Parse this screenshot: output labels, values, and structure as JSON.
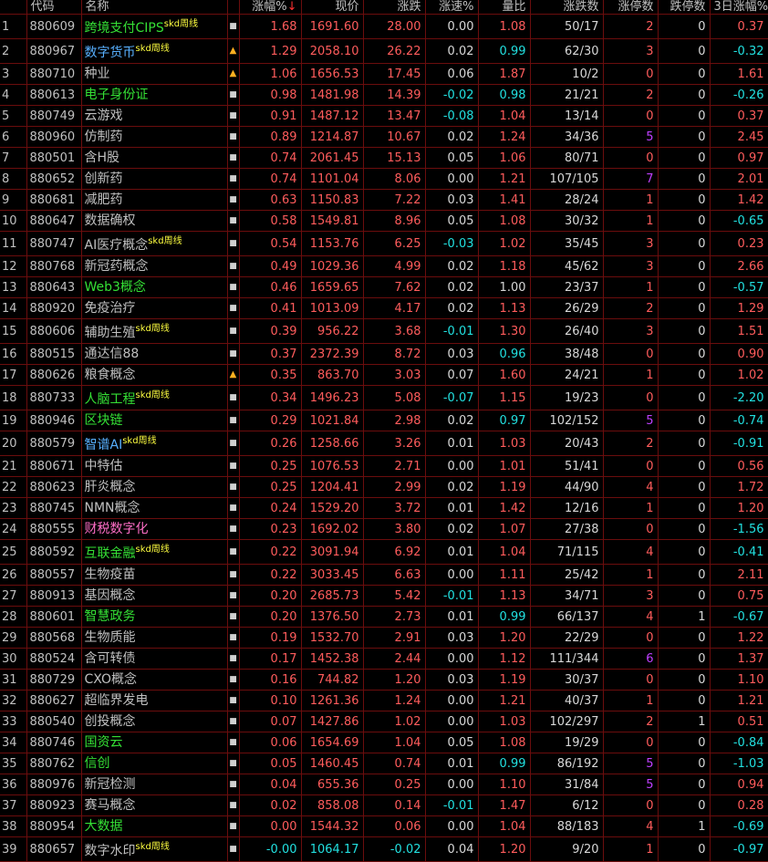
{
  "columns": [
    "代码",
    "名称",
    "",
    "涨幅%",
    "现价",
    "涨跌",
    "涨速%",
    "量比",
    "涨跌数",
    "涨停数",
    "跌停数",
    "3日涨幅%"
  ],
  "rows": [
    {
      "i": "1",
      "code": "880609",
      "name": "跨境支付CIPS",
      "nc": "n-green",
      "skd": "skd周线",
      "bell": "",
      "pct": "1.68",
      "price": "1691.60",
      "chg": "28.00",
      "spd": "0.00",
      "vol": "1.08",
      "vc": "red",
      "ud": "50/17",
      "up": "2",
      "upc": "red",
      "dn": "0",
      "d3": "0.37",
      "d3c": "red"
    },
    {
      "i": "2",
      "code": "880967",
      "name": "数字货币",
      "nc": "n-blue",
      "skd": "skd周线",
      "bell": "bell",
      "pct": "1.29",
      "price": "2058.10",
      "chg": "26.22",
      "spd": "0.02",
      "vol": "0.99",
      "vc": "cyan",
      "ud": "62/30",
      "up": "3",
      "upc": "red",
      "dn": "0",
      "d3": "-0.32",
      "d3c": "cyan"
    },
    {
      "i": "3",
      "code": "880710",
      "name": "种业",
      "nc": "n-default",
      "skd": "",
      "bell": "bell",
      "pct": "1.06",
      "price": "1656.53",
      "chg": "17.45",
      "spd": "0.06",
      "vol": "1.87",
      "vc": "red",
      "ud": "10/2",
      "up": "0",
      "upc": "red",
      "dn": "0",
      "d3": "1.61",
      "d3c": "red"
    },
    {
      "i": "4",
      "code": "880613",
      "name": "电子身份证",
      "nc": "n-green",
      "skd": "",
      "bell": "",
      "pct": "0.98",
      "price": "1481.98",
      "chg": "14.39",
      "spd": "-0.02",
      "vol": "0.98",
      "vc": "cyan",
      "ud": "21/21",
      "up": "2",
      "upc": "red",
      "dn": "0",
      "d3": "-0.26",
      "d3c": "cyan"
    },
    {
      "i": "5",
      "code": "880749",
      "name": "云游戏",
      "nc": "n-default",
      "skd": "",
      "bell": "",
      "pct": "0.91",
      "price": "1487.12",
      "chg": "13.47",
      "spd": "-0.08",
      "vol": "1.04",
      "vc": "red",
      "ud": "13/14",
      "up": "0",
      "upc": "red",
      "dn": "0",
      "d3": "0.37",
      "d3c": "red"
    },
    {
      "i": "6",
      "code": "880960",
      "name": "仿制药",
      "nc": "n-default",
      "skd": "",
      "bell": "",
      "pct": "0.89",
      "price": "1214.87",
      "chg": "10.67",
      "spd": "0.02",
      "vol": "1.24",
      "vc": "red",
      "ud": "34/36",
      "up": "5",
      "upc": "mag",
      "dn": "0",
      "d3": "2.45",
      "d3c": "red"
    },
    {
      "i": "7",
      "code": "880501",
      "name": "含H股",
      "nc": "n-default",
      "skd": "",
      "bell": "",
      "pct": "0.74",
      "price": "2061.45",
      "chg": "15.13",
      "spd": "0.05",
      "vol": "1.06",
      "vc": "red",
      "ud": "80/71",
      "up": "0",
      "upc": "red",
      "dn": "0",
      "d3": "0.97",
      "d3c": "red"
    },
    {
      "i": "8",
      "code": "880652",
      "name": "创新药",
      "nc": "n-default",
      "skd": "",
      "bell": "",
      "pct": "0.74",
      "price": "1101.04",
      "chg": "8.06",
      "spd": "0.00",
      "vol": "1.21",
      "vc": "red",
      "ud": "107/105",
      "up": "7",
      "upc": "mag",
      "dn": "0",
      "d3": "2.01",
      "d3c": "red"
    },
    {
      "i": "9",
      "code": "880681",
      "name": "减肥药",
      "nc": "n-default",
      "skd": "",
      "bell": "",
      "pct": "0.63",
      "price": "1150.83",
      "chg": "7.22",
      "spd": "0.03",
      "vol": "1.41",
      "vc": "red",
      "ud": "28/24",
      "up": "1",
      "upc": "red",
      "dn": "0",
      "d3": "1.42",
      "d3c": "red"
    },
    {
      "i": "10",
      "code": "880647",
      "name": "数据确权",
      "nc": "n-default",
      "skd": "",
      "bell": "",
      "pct": "0.58",
      "price": "1549.81",
      "chg": "8.96",
      "spd": "0.05",
      "vol": "1.08",
      "vc": "red",
      "ud": "30/32",
      "up": "1",
      "upc": "red",
      "dn": "0",
      "d3": "-0.65",
      "d3c": "cyan"
    },
    {
      "i": "11",
      "code": "880747",
      "name": "AI医疗概念",
      "nc": "n-default",
      "skd": "skd周线",
      "bell": "",
      "pct": "0.54",
      "price": "1153.76",
      "chg": "6.25",
      "spd": "-0.03",
      "vol": "1.02",
      "vc": "red",
      "ud": "35/45",
      "up": "3",
      "upc": "red",
      "dn": "0",
      "d3": "0.23",
      "d3c": "red"
    },
    {
      "i": "12",
      "code": "880768",
      "name": "新冠药概念",
      "nc": "n-default",
      "skd": "",
      "bell": "",
      "pct": "0.49",
      "price": "1029.36",
      "chg": "4.99",
      "spd": "0.02",
      "vol": "1.18",
      "vc": "red",
      "ud": "45/62",
      "up": "3",
      "upc": "red",
      "dn": "0",
      "d3": "2.66",
      "d3c": "red"
    },
    {
      "i": "13",
      "code": "880643",
      "name": "Web3概念",
      "nc": "n-green",
      "skd": "",
      "bell": "",
      "pct": "0.46",
      "price": "1659.65",
      "chg": "7.62",
      "spd": "0.02",
      "vol": "1.00",
      "vc": "white",
      "ud": "23/37",
      "up": "1",
      "upc": "red",
      "dn": "0",
      "d3": "-0.57",
      "d3c": "cyan"
    },
    {
      "i": "14",
      "code": "880920",
      "name": "免疫治疗",
      "nc": "n-default",
      "skd": "",
      "bell": "",
      "pct": "0.41",
      "price": "1013.09",
      "chg": "4.17",
      "spd": "0.02",
      "vol": "1.13",
      "vc": "red",
      "ud": "26/29",
      "up": "2",
      "upc": "red",
      "dn": "0",
      "d3": "1.29",
      "d3c": "red"
    },
    {
      "i": "15",
      "code": "880606",
      "name": "辅助生殖",
      "nc": "n-default",
      "skd": "skd周线",
      "bell": "",
      "pct": "0.39",
      "price": "956.22",
      "chg": "3.68",
      "spd": "-0.01",
      "vol": "1.30",
      "vc": "red",
      "ud": "26/40",
      "up": "3",
      "upc": "red",
      "dn": "0",
      "d3": "1.51",
      "d3c": "red"
    },
    {
      "i": "16",
      "code": "880515",
      "name": "通达信88",
      "nc": "n-default",
      "skd": "",
      "bell": "",
      "pct": "0.37",
      "price": "2372.39",
      "chg": "8.72",
      "spd": "0.03",
      "vol": "0.96",
      "vc": "cyan",
      "ud": "38/48",
      "up": "0",
      "upc": "red",
      "dn": "0",
      "d3": "0.90",
      "d3c": "red"
    },
    {
      "i": "17",
      "code": "880626",
      "name": "粮食概念",
      "nc": "n-default",
      "skd": "",
      "bell": "bell",
      "pct": "0.35",
      "price": "863.70",
      "chg": "3.03",
      "spd": "0.07",
      "vol": "1.60",
      "vc": "red",
      "ud": "24/21",
      "up": "1",
      "upc": "red",
      "dn": "0",
      "d3": "1.02",
      "d3c": "red"
    },
    {
      "i": "18",
      "code": "880733",
      "name": "人脑工程",
      "nc": "n-green",
      "skd": "skd周线",
      "bell": "",
      "pct": "0.34",
      "price": "1496.23",
      "chg": "5.08",
      "spd": "-0.07",
      "vol": "1.15",
      "vc": "red",
      "ud": "19/23",
      "up": "0",
      "upc": "red",
      "dn": "0",
      "d3": "-2.20",
      "d3c": "cyan"
    },
    {
      "i": "19",
      "code": "880946",
      "name": "区块链",
      "nc": "n-green",
      "skd": "",
      "bell": "",
      "pct": "0.29",
      "price": "1021.84",
      "chg": "2.98",
      "spd": "0.02",
      "vol": "0.97",
      "vc": "cyan",
      "ud": "102/152",
      "up": "5",
      "upc": "mag",
      "dn": "0",
      "d3": "-0.74",
      "d3c": "cyan"
    },
    {
      "i": "20",
      "code": "880579",
      "name": "智谱AI",
      "nc": "n-blue",
      "skd": "skd周线",
      "bell": "",
      "pct": "0.26",
      "price": "1258.66",
      "chg": "3.26",
      "spd": "0.01",
      "vol": "1.03",
      "vc": "red",
      "ud": "20/43",
      "up": "2",
      "upc": "red",
      "dn": "0",
      "d3": "-0.91",
      "d3c": "cyan"
    },
    {
      "i": "21",
      "code": "880671",
      "name": "中特估",
      "nc": "n-default",
      "skd": "",
      "bell": "",
      "pct": "0.25",
      "price": "1076.53",
      "chg": "2.71",
      "spd": "0.00",
      "vol": "1.01",
      "vc": "red",
      "ud": "51/41",
      "up": "0",
      "upc": "red",
      "dn": "0",
      "d3": "0.56",
      "d3c": "red"
    },
    {
      "i": "22",
      "code": "880623",
      "name": "肝炎概念",
      "nc": "n-default",
      "skd": "",
      "bell": "",
      "pct": "0.25",
      "price": "1204.41",
      "chg": "2.99",
      "spd": "0.02",
      "vol": "1.19",
      "vc": "red",
      "ud": "44/90",
      "up": "4",
      "upc": "red",
      "dn": "0",
      "d3": "1.72",
      "d3c": "red"
    },
    {
      "i": "23",
      "code": "880745",
      "name": "NMN概念",
      "nc": "n-default",
      "skd": "",
      "bell": "",
      "pct": "0.24",
      "price": "1529.20",
      "chg": "3.72",
      "spd": "0.01",
      "vol": "1.42",
      "vc": "red",
      "ud": "12/16",
      "up": "1",
      "upc": "red",
      "dn": "0",
      "d3": "1.20",
      "d3c": "red"
    },
    {
      "i": "24",
      "code": "880555",
      "name": "财税数字化",
      "nc": "n-pink",
      "skd": "",
      "bell": "",
      "pct": "0.23",
      "price": "1692.02",
      "chg": "3.80",
      "spd": "0.02",
      "vol": "1.07",
      "vc": "red",
      "ud": "27/38",
      "up": "0",
      "upc": "red",
      "dn": "0",
      "d3": "-1.56",
      "d3c": "cyan"
    },
    {
      "i": "25",
      "code": "880592",
      "name": "互联金融",
      "nc": "n-green",
      "skd": "skd周线",
      "bell": "",
      "pct": "0.22",
      "price": "3091.94",
      "chg": "6.92",
      "spd": "0.01",
      "vol": "1.04",
      "vc": "red",
      "ud": "71/115",
      "up": "4",
      "upc": "red",
      "dn": "0",
      "d3": "-0.41",
      "d3c": "cyan"
    },
    {
      "i": "26",
      "code": "880557",
      "name": "生物疫苗",
      "nc": "n-default",
      "skd": "",
      "bell": "",
      "pct": "0.22",
      "price": "3033.45",
      "chg": "6.63",
      "spd": "0.00",
      "vol": "1.11",
      "vc": "red",
      "ud": "25/42",
      "up": "1",
      "upc": "red",
      "dn": "0",
      "d3": "2.11",
      "d3c": "red"
    },
    {
      "i": "27",
      "code": "880913",
      "name": "基因概念",
      "nc": "n-default",
      "skd": "",
      "bell": "",
      "pct": "0.20",
      "price": "2685.73",
      "chg": "5.42",
      "spd": "-0.01",
      "vol": "1.13",
      "vc": "red",
      "ud": "34/71",
      "up": "3",
      "upc": "red",
      "dn": "0",
      "d3": "0.75",
      "d3c": "red"
    },
    {
      "i": "28",
      "code": "880601",
      "name": "智慧政务",
      "nc": "n-green",
      "skd": "",
      "bell": "",
      "pct": "0.20",
      "price": "1376.50",
      "chg": "2.73",
      "spd": "0.01",
      "vol": "0.99",
      "vc": "cyan",
      "ud": "66/137",
      "up": "4",
      "upc": "red",
      "dn": "1",
      "d3": "-0.67",
      "d3c": "cyan"
    },
    {
      "i": "29",
      "code": "880568",
      "name": "生物质能",
      "nc": "n-default",
      "skd": "",
      "bell": "",
      "pct": "0.19",
      "price": "1532.70",
      "chg": "2.91",
      "spd": "0.03",
      "vol": "1.20",
      "vc": "red",
      "ud": "22/29",
      "up": "0",
      "upc": "red",
      "dn": "0",
      "d3": "1.22",
      "d3c": "red"
    },
    {
      "i": "30",
      "code": "880524",
      "name": "含可转债",
      "nc": "n-default",
      "skd": "",
      "bell": "",
      "pct": "0.17",
      "price": "1452.38",
      "chg": "2.44",
      "spd": "0.00",
      "vol": "1.12",
      "vc": "red",
      "ud": "111/344",
      "up": "6",
      "upc": "mag",
      "dn": "0",
      "d3": "1.37",
      "d3c": "red"
    },
    {
      "i": "31",
      "code": "880729",
      "name": "CXO概念",
      "nc": "n-default",
      "skd": "",
      "bell": "",
      "pct": "0.16",
      "price": "744.82",
      "chg": "1.20",
      "spd": "0.03",
      "vol": "1.19",
      "vc": "red",
      "ud": "30/37",
      "up": "0",
      "upc": "red",
      "dn": "0",
      "d3": "1.10",
      "d3c": "red"
    },
    {
      "i": "32",
      "code": "880627",
      "name": "超临界发电",
      "nc": "n-default",
      "skd": "",
      "bell": "",
      "pct": "0.10",
      "price": "1261.36",
      "chg": "1.24",
      "spd": "0.00",
      "vol": "1.21",
      "vc": "red",
      "ud": "40/37",
      "up": "1",
      "upc": "red",
      "dn": "0",
      "d3": "1.21",
      "d3c": "red"
    },
    {
      "i": "33",
      "code": "880540",
      "name": "创投概念",
      "nc": "n-default",
      "skd": "",
      "bell": "",
      "pct": "0.07",
      "price": "1427.86",
      "chg": "1.02",
      "spd": "0.00",
      "vol": "1.03",
      "vc": "red",
      "ud": "102/297",
      "up": "2",
      "upc": "red",
      "dn": "1",
      "d3": "0.51",
      "d3c": "red"
    },
    {
      "i": "34",
      "code": "880746",
      "name": "国资云",
      "nc": "n-green",
      "skd": "",
      "bell": "",
      "pct": "0.06",
      "price": "1654.69",
      "chg": "1.04",
      "spd": "0.05",
      "vol": "1.08",
      "vc": "red",
      "ud": "19/29",
      "up": "0",
      "upc": "red",
      "dn": "0",
      "d3": "-0.84",
      "d3c": "cyan"
    },
    {
      "i": "35",
      "code": "880762",
      "name": "信创",
      "nc": "n-green",
      "skd": "",
      "bell": "",
      "pct": "0.05",
      "price": "1460.45",
      "chg": "0.74",
      "spd": "0.01",
      "vol": "0.99",
      "vc": "cyan",
      "ud": "86/192",
      "up": "5",
      "upc": "mag",
      "dn": "0",
      "d3": "-1.03",
      "d3c": "cyan"
    },
    {
      "i": "36",
      "code": "880976",
      "name": "新冠检测",
      "nc": "n-default",
      "skd": "",
      "bell": "",
      "pct": "0.04",
      "price": "655.36",
      "chg": "0.25",
      "spd": "0.00",
      "vol": "1.10",
      "vc": "red",
      "ud": "31/84",
      "up": "5",
      "upc": "mag",
      "dn": "0",
      "d3": "0.94",
      "d3c": "red"
    },
    {
      "i": "37",
      "code": "880923",
      "name": "赛马概念",
      "nc": "n-default",
      "skd": "",
      "bell": "",
      "pct": "0.02",
      "price": "858.08",
      "chg": "0.14",
      "spd": "-0.01",
      "vol": "1.47",
      "vc": "red",
      "ud": "6/12",
      "up": "0",
      "upc": "red",
      "dn": "0",
      "d3": "0.28",
      "d3c": "red"
    },
    {
      "i": "38",
      "code": "880954",
      "name": "大数据",
      "nc": "n-green",
      "skd": "",
      "bell": "",
      "pct": "0.00",
      "price": "1544.32",
      "chg": "0.06",
      "spd": "0.00",
      "vol": "1.04",
      "vc": "red",
      "ud": "88/183",
      "up": "4",
      "upc": "red",
      "dn": "1",
      "d3": "-0.69",
      "d3c": "cyan"
    },
    {
      "i": "39",
      "code": "880657",
      "name": "数字水印",
      "nc": "n-default",
      "skd": "skd周线",
      "bell": "",
      "pct": "-0.00",
      "price": "1064.17",
      "chg": "-0.02",
      "spd": "0.04",
      "vol": "1.20",
      "vc": "red",
      "ud": "9/20",
      "up": "1",
      "upc": "red",
      "dn": "0",
      "d3": "-0.97",
      "d3c": "cyan"
    }
  ],
  "colors": {
    "background": "#000000",
    "grid": "#6b0d0d",
    "up": "#ff5c5c",
    "down": "#22e0e0",
    "header_rule": "#2a8a2a"
  },
  "icons": {
    "row_marker": "small-square-icon",
    "alert": "bell-icon"
  }
}
